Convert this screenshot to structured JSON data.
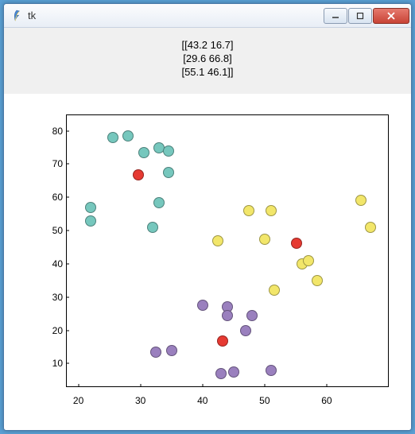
{
  "window": {
    "title": "tk",
    "icon_name": "feather-icon"
  },
  "banner": {
    "lines": [
      "[[43.2 16.7]",
      "[29.6 66.8]",
      "[55.1 46.1]]"
    ]
  },
  "chart_data": {
    "type": "scatter",
    "xlim": [
      18,
      70
    ],
    "ylim": [
      3,
      85
    ],
    "xticks": [
      20,
      30,
      40,
      50,
      60
    ],
    "yticks": [
      10,
      20,
      30,
      40,
      50,
      60,
      70,
      80
    ],
    "colors": {
      "teal": "#76c7bd",
      "purple": "#9a80be",
      "yellow": "#f2e66a",
      "red": "#e63a32"
    },
    "series": [
      {
        "name": "teal",
        "points": [
          {
            "x": 22,
            "y": 53
          },
          {
            "x": 22,
            "y": 57
          },
          {
            "x": 25.5,
            "y": 78
          },
          {
            "x": 28,
            "y": 78.5
          },
          {
            "x": 30.5,
            "y": 73.5
          },
          {
            "x": 33,
            "y": 75
          },
          {
            "x": 32,
            "y": 51
          },
          {
            "x": 33,
            "y": 58.5
          },
          {
            "x": 34.5,
            "y": 67.5
          },
          {
            "x": 34.5,
            "y": 74
          }
        ]
      },
      {
        "name": "purple",
        "points": [
          {
            "x": 32.5,
            "y": 13.5
          },
          {
            "x": 35,
            "y": 14
          },
          {
            "x": 40,
            "y": 27.5
          },
          {
            "x": 44,
            "y": 27
          },
          {
            "x": 44,
            "y": 24.5
          },
          {
            "x": 43,
            "y": 7
          },
          {
            "x": 45,
            "y": 7.5
          },
          {
            "x": 47,
            "y": 20
          },
          {
            "x": 48,
            "y": 24.5
          },
          {
            "x": 51,
            "y": 8
          }
        ]
      },
      {
        "name": "yellow",
        "points": [
          {
            "x": 42.5,
            "y": 47
          },
          {
            "x": 47.5,
            "y": 56
          },
          {
            "x": 50,
            "y": 47.5
          },
          {
            "x": 51,
            "y": 56
          },
          {
            "x": 51.5,
            "y": 32
          },
          {
            "x": 56,
            "y": 40
          },
          {
            "x": 57,
            "y": 41
          },
          {
            "x": 58.5,
            "y": 35
          },
          {
            "x": 65.5,
            "y": 59
          },
          {
            "x": 67,
            "y": 51
          }
        ]
      },
      {
        "name": "red",
        "points": [
          {
            "x": 29.6,
            "y": 66.8
          },
          {
            "x": 43.2,
            "y": 16.7
          },
          {
            "x": 55.1,
            "y": 46.1
          }
        ]
      }
    ]
  }
}
